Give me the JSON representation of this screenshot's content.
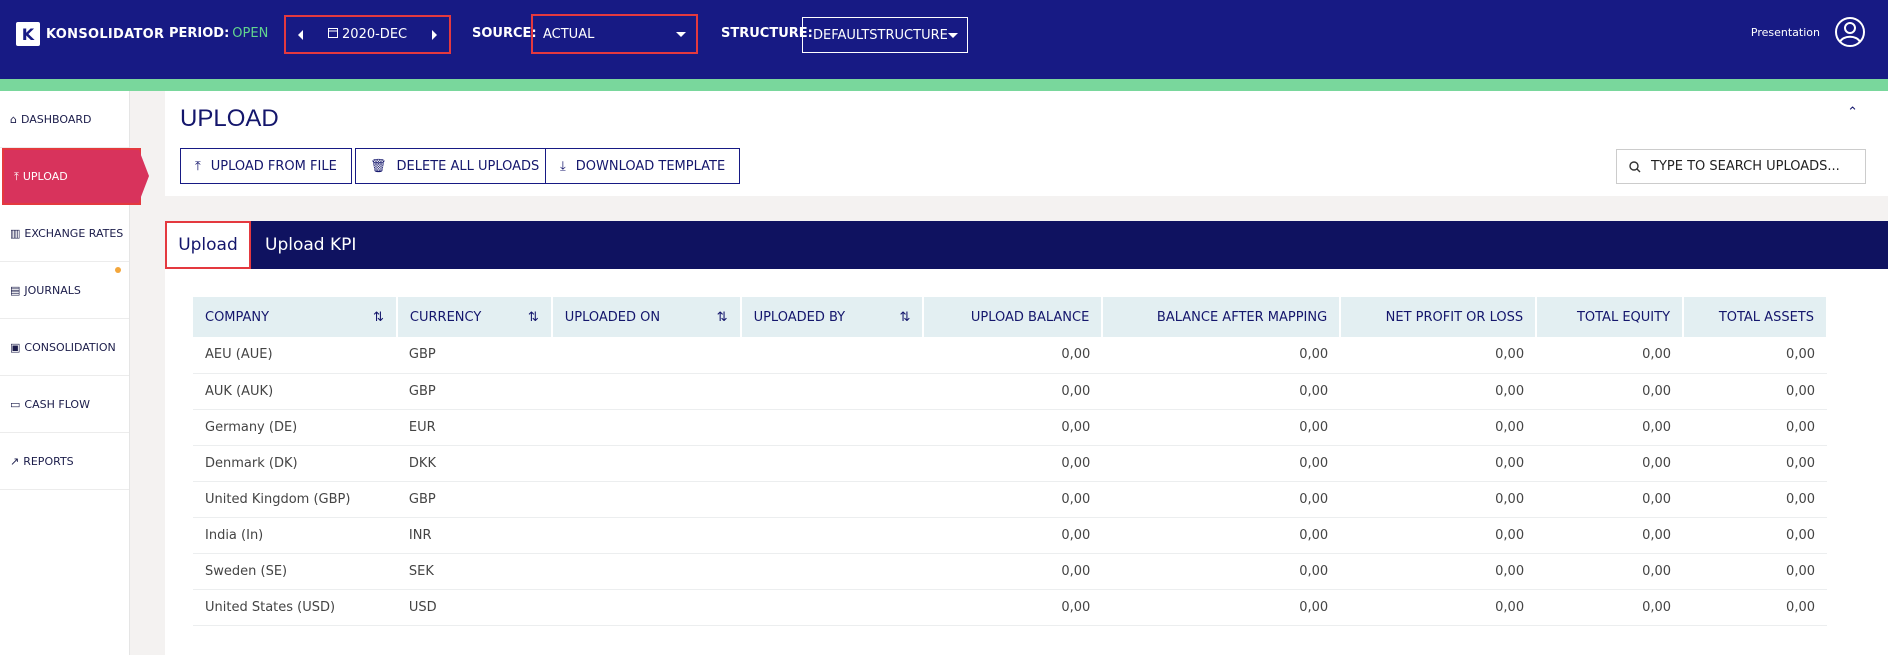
{
  "app": {
    "logo": "KONSOLIDATOR",
    "logo_mark": "K"
  },
  "topbar": {
    "period_label": "PERIOD:",
    "period_status": "OPEN",
    "period_value": "2020-DEC",
    "source_label": "SOURCE:",
    "source_value": "ACTUAL",
    "structure_label": "STRUCTURE:",
    "structure_value": "DEFAULTSTRUCTURE",
    "user_name": "Presentation"
  },
  "sidebar": {
    "items": [
      {
        "label": "DASHBOARD",
        "icon": "home-icon"
      },
      {
        "label": "UPLOAD",
        "icon": "upload-icon"
      },
      {
        "label": "EXCHANGE RATES",
        "icon": "chart-icon"
      },
      {
        "label": "JOURNALS",
        "icon": "journal-icon"
      },
      {
        "label": "CONSOLIDATION",
        "icon": "consolidation-icon"
      },
      {
        "label": "CASH FLOW",
        "icon": "cash-icon"
      },
      {
        "label": "REPORTS",
        "icon": "reports-icon"
      }
    ]
  },
  "main": {
    "title": "UPLOAD",
    "buttons": {
      "upload": "UPLOAD FROM FILE",
      "delete": "DELETE ALL UPLOADS",
      "download": "DOWNLOAD TEMPLATE"
    },
    "search_placeholder": "TYPE TO SEARCH UPLOADS...",
    "tabs": [
      "Upload",
      "Upload KPI"
    ]
  },
  "table": {
    "columns": [
      "COMPANY",
      "CURRENCY",
      "UPLOADED ON",
      "UPLOADED BY",
      "UPLOAD BALANCE",
      "BALANCE AFTER MAPPING",
      "NET PROFIT OR LOSS",
      "TOTAL EQUITY",
      "TOTAL ASSETS"
    ],
    "rows": [
      [
        "AEU (AUE)",
        "GBP",
        "",
        "",
        "0,00",
        "0,00",
        "0,00",
        "0,00",
        "0,00"
      ],
      [
        "AUK (AUK)",
        "GBP",
        "",
        "",
        "0,00",
        "0,00",
        "0,00",
        "0,00",
        "0,00"
      ],
      [
        "Germany (DE)",
        "EUR",
        "",
        "",
        "0,00",
        "0,00",
        "0,00",
        "0,00",
        "0,00"
      ],
      [
        "Denmark (DK)",
        "DKK",
        "",
        "",
        "0,00",
        "0,00",
        "0,00",
        "0,00",
        "0,00"
      ],
      [
        "United Kingdom (GBP)",
        "GBP",
        "",
        "",
        "0,00",
        "0,00",
        "0,00",
        "0,00",
        "0,00"
      ],
      [
        "India (In)",
        "INR",
        "",
        "",
        "0,00",
        "0,00",
        "0,00",
        "0,00",
        "0,00"
      ],
      [
        "Sweden (SE)",
        "SEK",
        "",
        "",
        "0,00",
        "0,00",
        "0,00",
        "0,00",
        "0,00"
      ],
      [
        "United States (USD)",
        "USD",
        "",
        "",
        "0,00",
        "0,00",
        "0,00",
        "0,00",
        "0,00"
      ]
    ]
  },
  "colors": {
    "header": "#171a84",
    "accent_green": "#79d79c",
    "active_red": "#d8335c",
    "tabs_bg": "#0f1260"
  }
}
